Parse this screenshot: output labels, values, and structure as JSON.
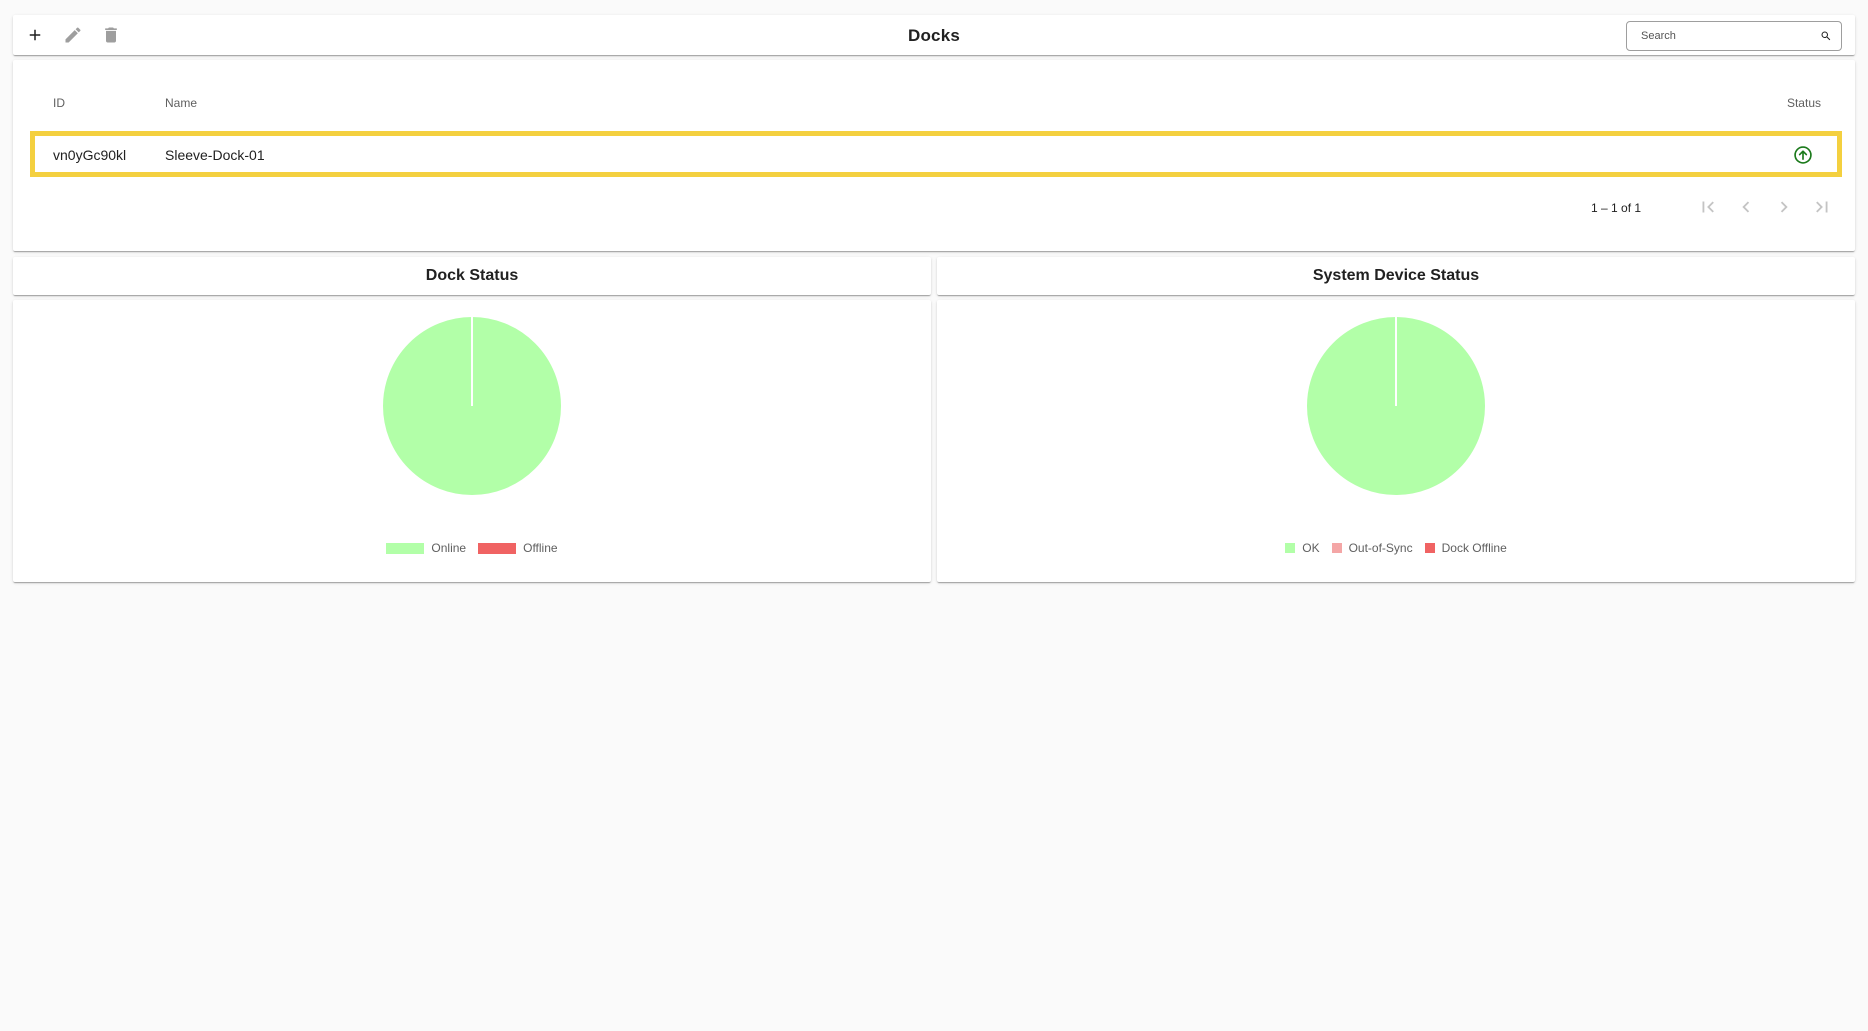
{
  "toolbar": {
    "title": "Docks",
    "search_placeholder": "Search",
    "icons": {
      "add": "add-icon",
      "edit": "edit-icon",
      "delete": "delete-icon",
      "search": "search-icon"
    }
  },
  "table": {
    "columns": {
      "id": "ID",
      "name": "Name",
      "status": "Status"
    },
    "rows": [
      {
        "id": "vn0yGc90kl",
        "name": "Sleeve-Dock-01",
        "status": "online",
        "status_icon": "arrow-up-circle-icon"
      }
    ],
    "selected_row_highlight": "#f4d03f",
    "pagination": {
      "range_label": "1 – 1 of 1",
      "icons": [
        "first-page-icon",
        "previous-page-icon",
        "next-page-icon",
        "last-page-icon"
      ]
    }
  },
  "dock_status": {
    "title": "Dock Status",
    "legend": [
      "Online",
      "Offline"
    ]
  },
  "system_device_status": {
    "title": "System Device Status",
    "legend": [
      "OK",
      "Out-of-Sync",
      "Dock Offline"
    ]
  },
  "colors": {
    "online": "#b2ffa8",
    "offline": "#f06363",
    "out_of_sync": "#f4a6a6",
    "dock_offline": "#f06363",
    "status_online_icon": "#1b7a1b",
    "highlight": "#f4d03f"
  },
  "chart_data": [
    {
      "type": "pie",
      "title": "Dock Status",
      "categories": [
        "Online",
        "Offline"
      ],
      "values": [
        1,
        0
      ],
      "colors": [
        "#b2ffa8",
        "#f06363"
      ],
      "legend_position": "bottom"
    },
    {
      "type": "pie",
      "title": "System Device Status",
      "categories": [
        "OK",
        "Out-of-Sync",
        "Dock Offline"
      ],
      "values": [
        1,
        0,
        0
      ],
      "colors": [
        "#b2ffa8",
        "#f4a6a6",
        "#f06363"
      ],
      "legend_position": "bottom"
    }
  ]
}
